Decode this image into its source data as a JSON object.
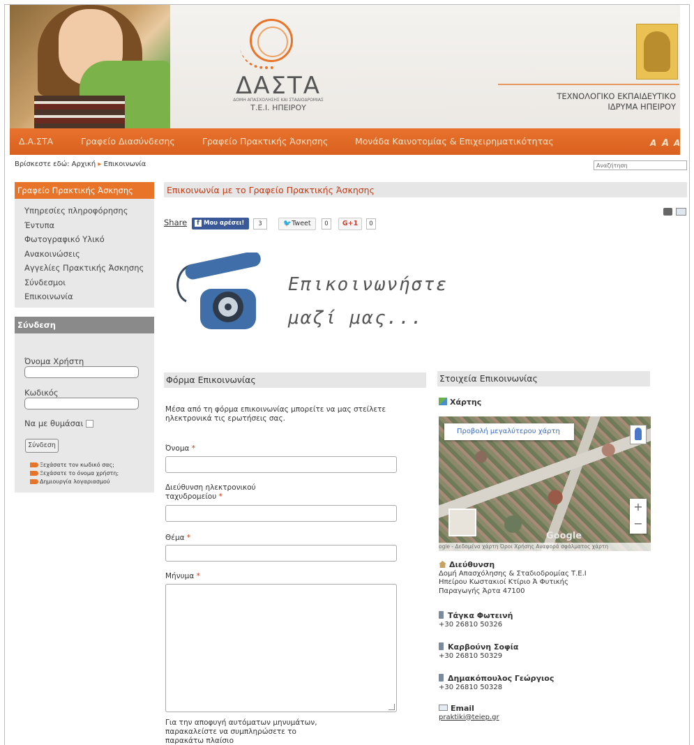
{
  "header": {
    "logo_title": "ΔΑΣΤΑ",
    "logo_subtitle": "ΔΟΜΗ ΑΠΑΣΧΟΛΗΣΗΣ ΚΑΙ ΣΤΑΔΙΟΔΡΟΜΙΑΣ",
    "logo_subtitle2": "Τ.Ε.Ι. ΗΠΕΙΡΟΥ",
    "institution_line1": "ΤΕΧΝΟΛΟΓΙΚΟ ΕΚΠΑΙΔΕΥΤΙΚΟ",
    "institution_line2": "ΙΔΡΥΜΑ ΗΠΕΙΡΟΥ"
  },
  "nav": {
    "items": [
      "Δ.Α.ΣΤΑ",
      "Γραφείο Διασύνδεσης",
      "Γραφείο Πρακτικής Άσκησης",
      "Μονάδα Καινοτομίας & Επιχειρηματικότητας"
    ],
    "font_sizes": [
      "A",
      "A",
      "A"
    ]
  },
  "breadcrumb": {
    "prefix": "Βρίσκεστε εδώ:",
    "home": "Αρχική",
    "current": "Επικοινωνία"
  },
  "search": {
    "placeholder": "Αναζήτηση"
  },
  "left_menu": {
    "title": "Γραφείο Πρακτικής Άσκησης",
    "items": [
      "Υπηρεσίες πληροφόρησης",
      "Έντυπα",
      "Φωτογραφικό Υλικό",
      "Ανακοινώσεις",
      "Αγγελίες Πρακτικής Άσκησης",
      "Σύνδεσμοι",
      "Επικοινωνία"
    ]
  },
  "login": {
    "title": "Σύνδεση",
    "username_label": "Όνομα Χρήστη",
    "password_label": "Κωδικός",
    "remember_label": "Να με θυμάσαι",
    "submit_label": "Σύνδεση",
    "links": [
      "Ξεχάσατε τον κωδικό σας;",
      "Ξεχάσατε το όνομα χρήστη;",
      "Δημιουργία λογαριασμού"
    ]
  },
  "page": {
    "title": "Επικοινωνία με το Γραφείο Πρακτικής Άσκησης",
    "share_label": "Share",
    "fb_label": "Μου αρέσει!",
    "fb_count": "3",
    "tweet_label": "Tweet",
    "tweet_count": "0",
    "gplus_label": "G+1",
    "gplus_count": "0",
    "banner_line1": "Επικοινωνήστε",
    "banner_line2": "μαζί μας..."
  },
  "form": {
    "title": "Φόρμα Επικοινωνίας",
    "intro": "Μέσα από τη φόρμα επικοινωνίας μπορείτε να μας στείλετε ηλεκτρονικά τις ερωτήσεις σας.",
    "name_label": "Όνομα",
    "email_label_1": "Διεύθυνση ηλεκτρονικού",
    "email_label_2": "ταχυδρομείου",
    "subject_label": "Θέμα",
    "message_label": "Μήνυμα",
    "required_mark": "*",
    "captcha_text": "Για την αποφυγή αυτόματων μηνυμάτων, παρακαλείστε να συμπληρώσετε το παρακάτω πλαίσιο"
  },
  "contact": {
    "title": "Στοιχεία Επικοινωνίας",
    "map_label": "Χάρτης",
    "map_button": "Προβολή μεγαλύτερου χάρτη",
    "map_footer": "ogle - Δεδομένα χάρτη   Όροι Χρήσης   Αναφορά σφάλματος χάρτη",
    "map_zoom_in": "+",
    "map_zoom_out": "−",
    "map_logo": "Google",
    "address_title": "Διεύθυνση",
    "address_lines": [
      "Δομή Απασχόλησης & Σταδιοδρομίας Τ.Ε.Ι",
      "Ηπείρου Κωστακιοί Κτίριο Ά Φυτικής",
      "Παραγωγής Άρτα 47100"
    ],
    "people": [
      {
        "name": "Τάγκα Φωτεινή",
        "phone": "+30 26810 50326"
      },
      {
        "name": "Καρβούνη Σοφία",
        "phone": "+30 26810 50329"
      },
      {
        "name": "Δημακόπουλος Γεώργιος",
        "phone": "+30 26810 50328"
      }
    ],
    "email_title": "Email",
    "email": "praktiki@teiep.gr"
  },
  "colors": {
    "accent": "#e8742a",
    "title_red": "#c23b14",
    "facebook": "#3b5998"
  }
}
